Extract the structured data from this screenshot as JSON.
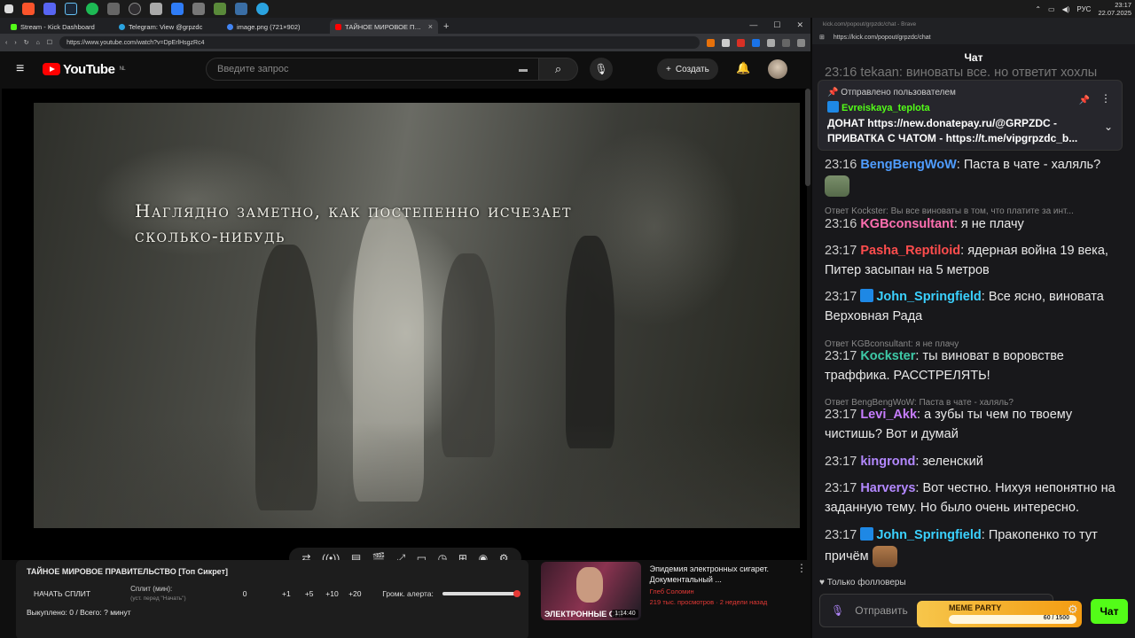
{
  "taskbar": {
    "lang": "РУС",
    "time": "23:17",
    "date": "22.07.2025"
  },
  "browser": {
    "tabs": [
      {
        "label": "Stream - Kick Dashboard",
        "color": "#53fc18"
      },
      {
        "label": "Telegram: View @grpzdc",
        "color": "#2aa3e0"
      },
      {
        "label": "image.png (721×902)",
        "color": "#4285f4"
      },
      {
        "label": "ТАЙНОЕ МИРОВОЕ ПРАВИТЕ...",
        "color": "#ff0000"
      }
    ],
    "url": "https://www.youtube.com/watch?v=DpErlHsgzRc4"
  },
  "youtube": {
    "logo": "YouTube",
    "region": "NL",
    "search_placeholder": "Введите запрос",
    "create_label": "Создать",
    "subtitle_line1": "Наглядно заметно, как постепенно исчезает",
    "subtitle_line2": "сколько-нибудь",
    "panel": {
      "title": "ТАЙНОЕ МИРОВОЕ ПРАВИТЕЛЬСТВО [Топ Сикрет]",
      "start_split": "НАЧАТЬ СПЛИТ",
      "split_label": "Сплит (мин):",
      "split_hint": "(уст. перед \"Начать\")",
      "split_value": "0",
      "inc": [
        "+1",
        "+5",
        "+10",
        "+20"
      ],
      "volume_label": "Громк. алерта:",
      "bought": "Выкуплено: 0 / Всего: ? минут"
    },
    "rec": {
      "title": "Эпидемия электронных сигарет. Документальный ...",
      "channel": "Глеб Соломин",
      "meta": "219 тыс. просмотров · 2 недели назад",
      "thumb_text": "ЭЛЕКТРОННЫЕ СИГ",
      "duration": "1:14:40"
    }
  },
  "chat": {
    "window_title": "kick.com/popout/grpzdc/chat - Brave",
    "url": "https://kick.com/popout/grpzdc/chat",
    "header": "Чат",
    "partial_top": "23:16 tekaan: виноваты все, но ответит хохлы",
    "pinned": {
      "label": "Отправлено пользователем",
      "user": "Evreiskaya_teplota",
      "line1": "ДОНАТ https://new.donatepay.ru/@GRPZDC -",
      "line2": "ПРИВАТКА С ЧАТОМ - https://t.me/vipgrpzdc_b..."
    },
    "messages": [
      {
        "time": "23:16",
        "user": "BengBengWoW",
        "color": "#4f9dff",
        "text": "Паста в чате - халяль?"
      },
      {
        "reply": "Ответ Kockster: Вы все виноваты в том, что платите за инт..."
      },
      {
        "time": "23:16",
        "user": "KGBconsultant",
        "color": "#ff6fb0",
        "text": "я не плачу"
      },
      {
        "time": "23:17",
        "user": "Pasha_Reptiloid",
        "color": "#ff4d4d",
        "text": "ядерная война 19 века, Питер засыпан на 5 метров"
      },
      {
        "time": "23:17",
        "user": "John_Springfield",
        "color": "#3bd1ff",
        "text": "Все ясно, виновата Верховная Рада"
      },
      {
        "reply": "Ответ KGBconsultant: я не плачу"
      },
      {
        "time": "23:17",
        "user": "Kockster",
        "color": "#3ec9a7",
        "text": "ты виноват в воровстве траффика. РАССТРЕЛЯТЬ!"
      },
      {
        "reply": "Ответ BengBengWoW: Паста в чате - халяль?"
      },
      {
        "time": "23:17",
        "user": "Levi_Akk",
        "color": "#c77dff",
        "text": "а зубы ты чем по твоему чистишь? Вот и думай"
      },
      {
        "time": "23:17",
        "user": "kingrond",
        "color": "#b388ff",
        "text": "зеленский"
      },
      {
        "time": "23:17",
        "user": "Harverys",
        "color": "#b388ff",
        "text": "Вот честно. Нихуя непонятно на заданную тему. Но было очень интересно."
      },
      {
        "time": "23:17",
        "user": "John_Springfield",
        "color": "#3bd1ff",
        "text": "Пракопенко то тут причём"
      }
    ],
    "followers_only": "Только фолловеры",
    "input_placeholder": "Отправить",
    "send_label": "Чат",
    "meme": {
      "title": "MEME PARTY",
      "progress": "60 / 1500"
    }
  }
}
